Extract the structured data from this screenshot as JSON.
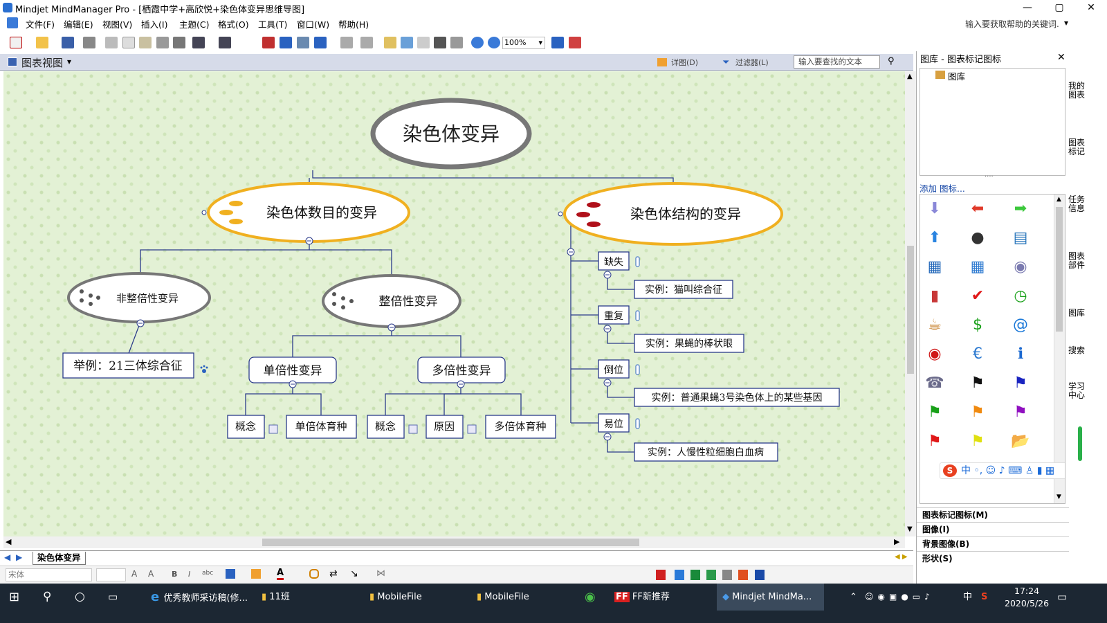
{
  "window": {
    "title": "Mindjet MindManager Pro - [栖霞中学+高欣悦+染色体变异思维导图]"
  },
  "menu": [
    "文件(F)",
    "编辑(E)",
    "视图(V)",
    "插入(I)",
    "主题(C)",
    "格式(O)",
    "工具(T)",
    "窗口(W)",
    "帮助(H)"
  ],
  "help_box": "输入要获取帮助的关键词.",
  "toolbar": {
    "zoom": "100%"
  },
  "view": {
    "title": "图表视图",
    "detail": "详图(D)",
    "filter": "过滤器(L)",
    "search_placeholder": "输入要查找的文本"
  },
  "map": {
    "root": "染色体变异",
    "left": {
      "title": "染色体数目的变异",
      "a": {
        "title": "非整倍性变异",
        "example": "举例：21三体综合征"
      },
      "b": {
        "title": "整倍性变异",
        "single": {
          "title": "单倍性变异",
          "c1": "概念",
          "c2": "单倍体育种"
        },
        "multi": {
          "title": "多倍性变异",
          "c1": "概念",
          "c2": "原因",
          "c3": "多倍体育种"
        }
      }
    },
    "right": {
      "title": "染色体结构的变异",
      "items": [
        {
          "label": "缺失",
          "example": "实例：猫叫综合征"
        },
        {
          "label": "重复",
          "example": "实例：果蝇的棒状眼"
        },
        {
          "label": "倒位",
          "example": "实例：普通果蝇3号染色体上的某些基因"
        },
        {
          "label": "易位",
          "example": "实例：人慢性粒细胞白血病"
        }
      ]
    }
  },
  "sheet_tab": "染色体变异",
  "format": {
    "font": "宋体"
  },
  "panel": {
    "title": "图库 - 图表标记图标",
    "tree_item": "图库",
    "add_link": "添加 图标...",
    "sections": [
      "图表标记图标(M)",
      "图像(I)",
      "背景图像(B)",
      "形状(S)"
    ],
    "ime": "中"
  },
  "side_tabs": [
    "我的图表",
    "图表标记",
    "任务信息",
    "图表部件",
    "图库",
    "搜索",
    "学习中心"
  ],
  "icons": [
    "arrow-down-icon",
    "arrow-left-icon",
    "arrow-right-icon",
    "arrow-up-icon",
    "bomb-icon",
    "book-icon",
    "phone-book-icon",
    "calendar-icon",
    "camera-icon",
    "fire-extinguisher-icon",
    "checkmark-icon",
    "clock-icon",
    "coffee-icon",
    "dollar-icon",
    "at-icon",
    "record-icon",
    "euro-icon",
    "info-icon",
    "phone-icon",
    "black-flag-icon",
    "blue-flag-icon",
    "green-flag-icon",
    "orange-flag-icon",
    "purple-flag-icon",
    "red-flag-icon",
    "yellow-flag-icon",
    "folder-icon"
  ],
  "icon_colors": [
    "#8a88d8",
    "#e03a2a",
    "#3cc83c",
    "#2a84e0",
    "#333",
    "#1f70b8",
    "#1e64b8",
    "#2a78d0",
    "#7a7ab0",
    "#c83838",
    "#e01818",
    "#18a018",
    "#c07010",
    "#18a018",
    "#1a78d8",
    "#d01818",
    "#2a78d0",
    "#1a68d0",
    "#6a6a8a",
    "#111",
    "#1a24c0",
    "#18a018",
    "#f08a10",
    "#9010c0",
    "#e01818",
    "#e0e010",
    "#f0c040"
  ],
  "icon_glyphs": [
    "⬇",
    "⬅",
    "➡",
    "⬆",
    "●",
    "▤",
    "▦",
    "▦",
    "◉",
    "▮",
    "✔",
    "◷",
    "☕",
    "$",
    "@",
    "◉",
    "€",
    "ℹ",
    "☎",
    "⚑",
    "⚑",
    "⚑",
    "⚑",
    "⚑",
    "⚑",
    "⚑",
    "📂"
  ],
  "taskbar": {
    "items": [
      "优秀教师采访稿(修...",
      "11班",
      "MobileFile",
      "MobileFile",
      "FF新推荐",
      "Mindjet MindMa..."
    ],
    "time": "17:24",
    "date": "2020/5/26",
    "ime": "中"
  }
}
